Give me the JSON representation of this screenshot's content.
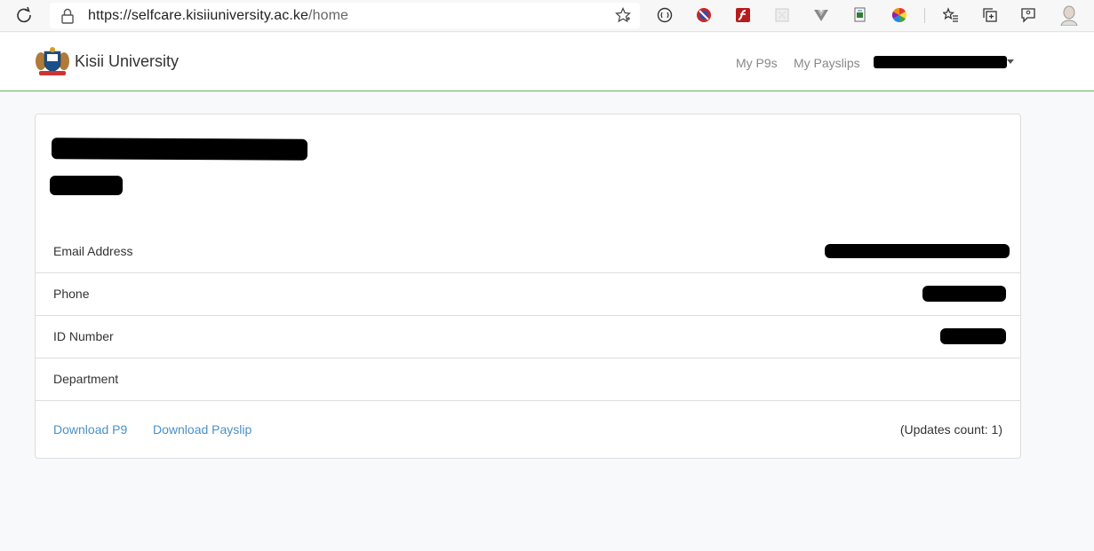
{
  "browser": {
    "url_host": "https://selfcare.kisiiuniversity.ac.ke",
    "url_path": "/home",
    "icons": [
      "reload-icon",
      "lock-icon",
      "favorite-star-icon",
      "reader-icon",
      "extension-icon",
      "flash-icon",
      "extension-icon",
      "vue-icon",
      "extension-icon",
      "color-picker-icon",
      "favorites-icon",
      "collections-icon",
      "feedback-icon",
      "profile-icon"
    ]
  },
  "navbar": {
    "brand": "Kisii University",
    "links": {
      "p9s": "My P9s",
      "payslips": "My Payslips"
    },
    "accent_color": "#5cb85c"
  },
  "profile": {
    "fields": [
      {
        "label": "Email Address"
      },
      {
        "label": "Phone"
      },
      {
        "label": "ID Number"
      },
      {
        "label": "Department"
      }
    ],
    "actions": {
      "download_p9": "Download P9",
      "download_payslip": "Download Payslip"
    },
    "updates_count": "(Updates count: 1)",
    "link_color": "#4a90c8"
  }
}
